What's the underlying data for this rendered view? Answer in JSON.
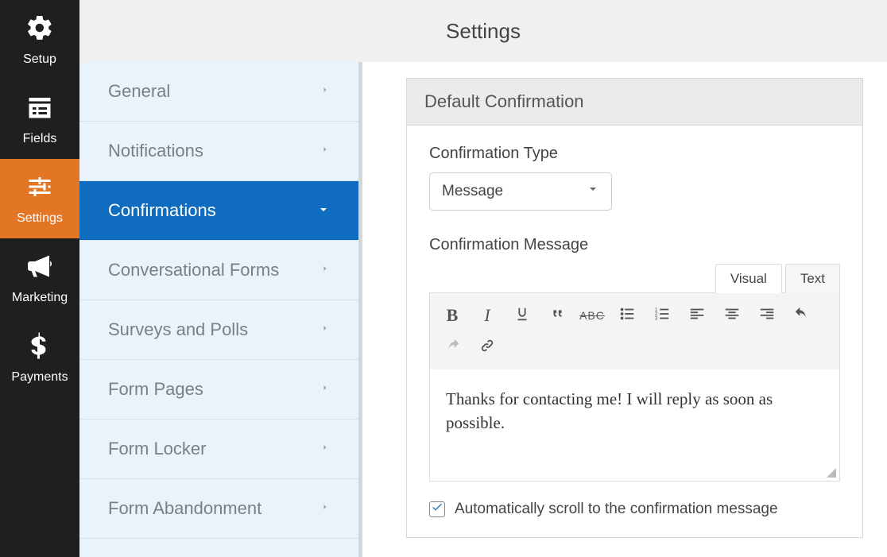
{
  "nav": {
    "items": [
      {
        "label": "Setup",
        "icon": "gear"
      },
      {
        "label": "Fields",
        "icon": "list"
      },
      {
        "label": "Settings",
        "icon": "sliders"
      },
      {
        "label": "Marketing",
        "icon": "bullhorn"
      },
      {
        "label": "Payments",
        "icon": "dollar"
      }
    ]
  },
  "header": {
    "title": "Settings"
  },
  "settings_list": [
    {
      "label": "General"
    },
    {
      "label": "Notifications"
    },
    {
      "label": "Confirmations"
    },
    {
      "label": "Conversational Forms"
    },
    {
      "label": "Surveys and Polls"
    },
    {
      "label": "Form Pages"
    },
    {
      "label": "Form Locker"
    },
    {
      "label": "Form Abandonment"
    }
  ],
  "card": {
    "title": "Default Confirmation",
    "type_label": "Confirmation Type",
    "type_value": "Message",
    "message_label": "Confirmation Message",
    "tabs": {
      "visual": "Visual",
      "text": "Text"
    },
    "message_value": "Thanks for contacting me! I will reply as soon as possible.",
    "auto_scroll_label": "Automatically scroll to the confirmation message",
    "auto_scroll_checked": true,
    "toolbar": {
      "bold": "B",
      "italic": "I",
      "underline": "U",
      "strike": "ABC"
    }
  }
}
